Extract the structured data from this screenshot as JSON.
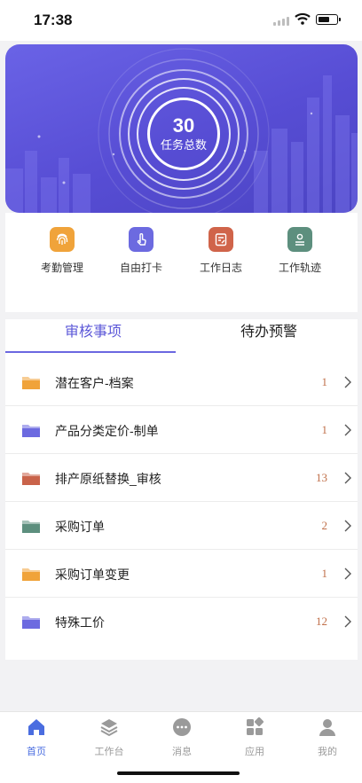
{
  "status_bar": {
    "time": "17:38"
  },
  "banner": {
    "task_total": "30",
    "task_total_label": "任务总数"
  },
  "shortcuts": [
    {
      "label": "考勤管理",
      "color": "#f0a33a",
      "icon": "fingerprint-icon"
    },
    {
      "label": "自由打卡",
      "color": "#6c6ae0",
      "icon": "hand-tap-icon"
    },
    {
      "label": "工作日志",
      "color": "#d0644a",
      "icon": "journal-icon"
    },
    {
      "label": "工作轨迹",
      "color": "#5d8f7e",
      "icon": "route-icon"
    }
  ],
  "tabs": {
    "active": "审核事项",
    "inactive": "待办预警"
  },
  "list": [
    {
      "name": "潜在客户-档案",
      "count": "1",
      "color": "#f0a33a"
    },
    {
      "name": "产品分类定价-制单",
      "count": "1",
      "color": "#6c6ae0"
    },
    {
      "name": "排产原纸替换_审核",
      "count": "13",
      "color": "#c9634a"
    },
    {
      "name": "采购订单",
      "count": "2",
      "color": "#5d8f7e"
    },
    {
      "name": "采购订单变更",
      "count": "1",
      "color": "#f0a33a"
    },
    {
      "name": "特殊工价",
      "count": "12",
      "color": "#6c6ae0"
    }
  ],
  "tabbar": [
    {
      "label": "首页",
      "icon": "home-icon",
      "active": true
    },
    {
      "label": "工作台",
      "icon": "layers-icon",
      "active": false
    },
    {
      "label": "消息",
      "icon": "message-icon",
      "active": false
    },
    {
      "label": "应用",
      "icon": "apps-icon",
      "active": false
    },
    {
      "label": "我的",
      "icon": "user-icon",
      "active": false
    }
  ]
}
